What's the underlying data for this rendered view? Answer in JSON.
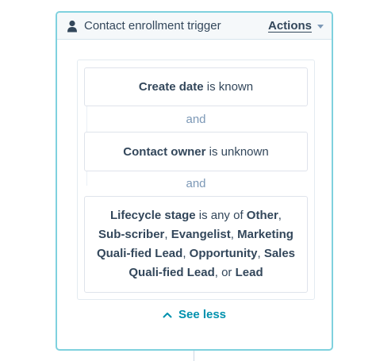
{
  "header": {
    "icon": "person-icon",
    "title": "Contact enrollment trigger",
    "actions_label": "Actions"
  },
  "filters": [
    {
      "property": "Create date",
      "condition": " is known"
    },
    {
      "property": "Contact owner",
      "condition": " is unknown"
    },
    {
      "property": "Lifecycle stage",
      "condition": " is any of ",
      "values": [
        "Other",
        "Sub-scriber",
        "Evangelist",
        "Marketing Quali-fied Lead",
        "Opportunity",
        "Sales Quali-fied Lead",
        "Lead"
      ]
    }
  ],
  "and_labels": [
    "and",
    "and"
  ],
  "see_less_label": "See less",
  "colors": {
    "border_accent": "#7fd1de",
    "link": "#0091ae",
    "text": "#33475b",
    "muted": "#7c98b6"
  }
}
